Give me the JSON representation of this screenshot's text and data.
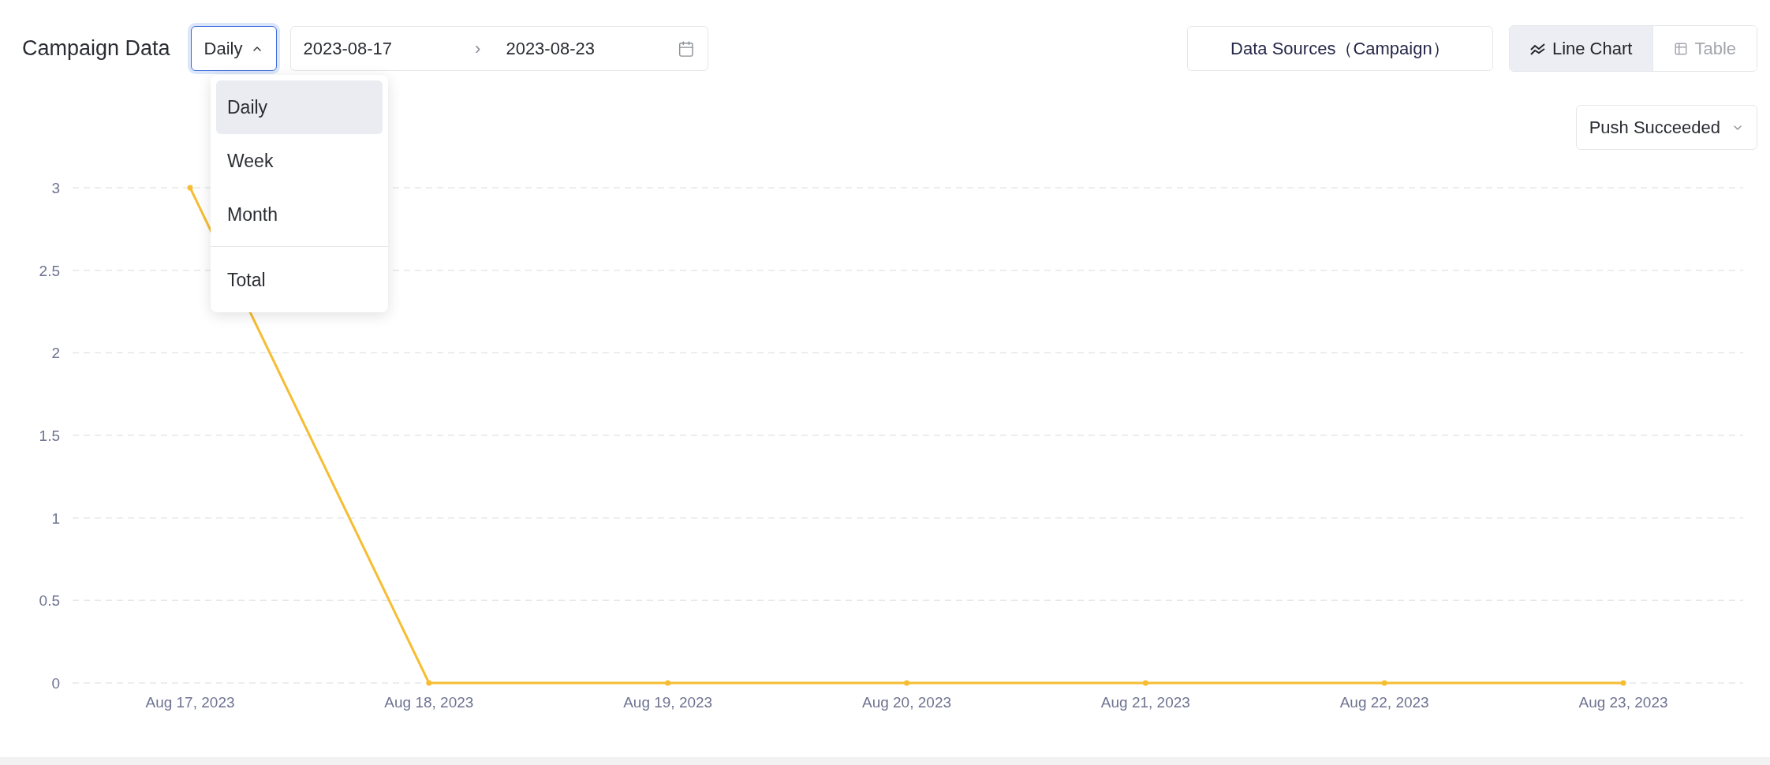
{
  "header": {
    "title": "Campaign Data",
    "granularity": {
      "value": "Daily",
      "expanded": true
    },
    "date_range": {
      "start": "2023-08-17",
      "separator": "›",
      "end": "2023-08-23"
    },
    "data_sources_button": "Data Sources（Campaign）",
    "view_tabs": [
      {
        "label": "Line Chart",
        "kind": "line",
        "selected": true
      },
      {
        "label": "Table",
        "kind": "table",
        "selected": false
      }
    ]
  },
  "granularity_menu": {
    "items": [
      {
        "label": "Daily",
        "selected": true
      },
      {
        "label": "Week",
        "selected": false
      },
      {
        "label": "Month",
        "selected": false
      }
    ],
    "footer_items": [
      {
        "label": "Total",
        "selected": false
      }
    ]
  },
  "metric_select": {
    "value": "Push Succeeded"
  },
  "chart": {
    "chart_data": {
      "type": "line",
      "categories": [
        "Aug 17, 2023",
        "Aug 18, 2023",
        "Aug 19, 2023",
        "Aug 20, 2023",
        "Aug 21, 2023",
        "Aug 22, 2023",
        "Aug 23, 2023"
      ],
      "series": [
        {
          "color": "#f6bd32",
          "marker": true,
          "values": [
            3,
            0,
            0,
            0,
            0,
            0,
            0
          ]
        }
      ],
      "grid": true,
      "ylim": [
        0,
        3
      ],
      "yticks": [
        0,
        0.5,
        1,
        1.5,
        2,
        2.5,
        3
      ]
    }
  }
}
